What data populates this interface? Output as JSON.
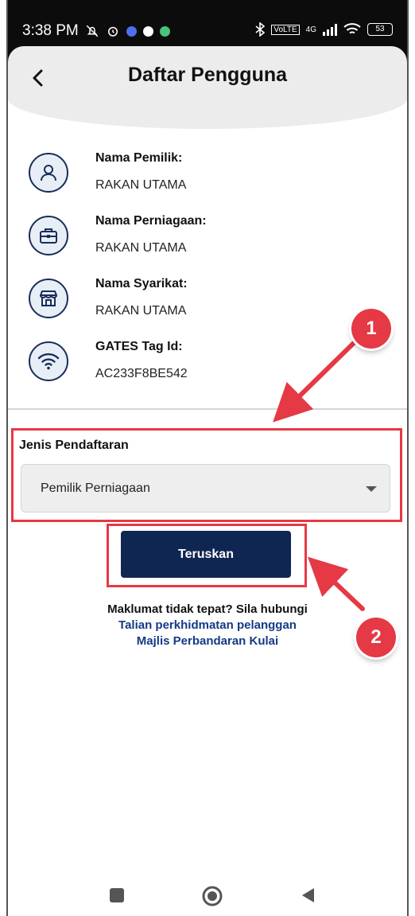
{
  "status_bar": {
    "time": "3:38 PM",
    "network": "4G",
    "battery": "53"
  },
  "header": {
    "title": "Daftar Pengguna",
    "back_icon": "chevron-left-icon"
  },
  "user_info": [
    {
      "label": "Nama Pemilik:",
      "value": "RAKAN UTAMA",
      "icon": "user-icon"
    },
    {
      "label": "Nama Perniagaan:",
      "value": "RAKAN UTAMA",
      "icon": "briefcase-icon"
    },
    {
      "label": "Nama Syarikat:",
      "value": "RAKAN UTAMA",
      "icon": "store-icon"
    },
    {
      "label": "GATES Tag Id:",
      "value": "AC233F8BE542",
      "icon": "wifi-icon"
    }
  ],
  "registration": {
    "label": "Jenis Pendaftaran",
    "selected": "Pemilik Perniagaan"
  },
  "continue_button": "Teruskan",
  "footer": {
    "question": "Maklumat tidak tepat? Sila hubungi",
    "link_line1": "Talian perkhidmatan pelanggan",
    "link_line2": "Majlis Perbandaran Kulai"
  },
  "annotations": {
    "badge1": "1",
    "badge2": "2",
    "color": "#e53945"
  },
  "colors": {
    "primary": "#102652",
    "link": "#143a86",
    "icon_bg": "#e8eef6"
  }
}
